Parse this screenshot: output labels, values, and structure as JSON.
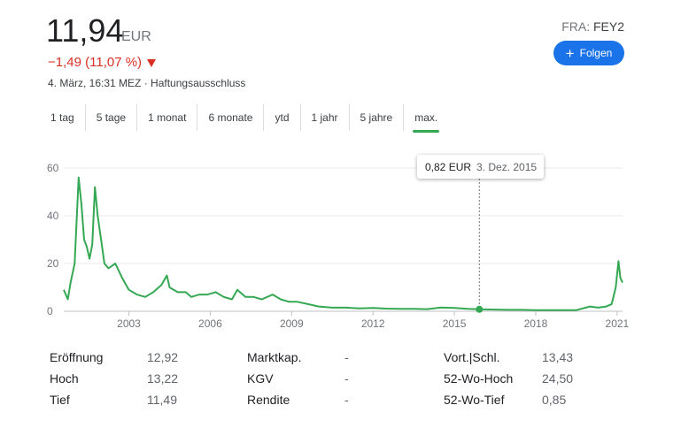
{
  "quote": {
    "price": "11,94",
    "currency": "EUR",
    "change": "−1,49 (11,07 %)",
    "meta": "4. März, 16:31 MEZ · Haftungsausschluss",
    "exchange": "FRA:",
    "symbol": "FEY2",
    "follow_label": "Folgen",
    "change_color": "#d93025"
  },
  "tabs": [
    "1 tag",
    "5 tage",
    "1 monat",
    "6 monate",
    "ytd",
    "1 jahr",
    "5 jahre",
    "max."
  ],
  "active_tab": "max.",
  "tooltip": {
    "price": "0,82 EUR",
    "date": "3. Dez. 2015"
  },
  "chart_data": {
    "type": "line",
    "x_ticks": [
      "2003",
      "2006",
      "2009",
      "2012",
      "2015",
      "2018",
      "2021"
    ],
    "y_ticks": [
      "60",
      "40",
      "20",
      "0"
    ],
    "ylim": [
      0,
      60
    ],
    "xlim": [
      2000.6,
      2021.2
    ],
    "line_color": "#34a853",
    "series": [
      {
        "x": [
          2000.6,
          2000.75,
          2000.85,
          2001.0,
          2001.15,
          2001.25,
          2001.35,
          2001.45,
          2001.55,
          2001.65,
          2001.75,
          2001.85,
          2002.0,
          2002.1,
          2002.25,
          2002.5,
          2002.75,
          2003.0,
          2003.3,
          2003.6,
          2003.9,
          2004.2,
          2004.4,
          2004.5,
          2004.8,
          2005.1,
          2005.3,
          2005.6,
          2005.9,
          2006.2,
          2006.5,
          2006.8,
          2007.0,
          2007.3,
          2007.6,
          2007.9,
          2008.1,
          2008.3,
          2008.6,
          2008.9,
          2009.2,
          2009.6,
          2010.0,
          2010.5,
          2011.0,
          2011.5,
          2012.0,
          2012.5,
          2013.0,
          2013.5,
          2014.0,
          2014.5,
          2015.0,
          2015.5,
          2015.92,
          2016.5,
          2017.0,
          2017.5,
          2018.0,
          2018.5,
          2019.0,
          2019.5,
          2020.0,
          2020.3,
          2020.6,
          2020.8,
          2020.95,
          2021.05,
          2021.12,
          2021.2
        ],
        "y": [
          9,
          5,
          12,
          20,
          56,
          45,
          30,
          27,
          22,
          28,
          52,
          40,
          28,
          20,
          18,
          20,
          14,
          9,
          7,
          6,
          8,
          11,
          15,
          10,
          8,
          8,
          6,
          7,
          7,
          8,
          6,
          5,
          9,
          6,
          6,
          5,
          6,
          7,
          5,
          4,
          4,
          3,
          2,
          1.5,
          1.5,
          1.2,
          1.4,
          1.1,
          1.0,
          1.0,
          0.9,
          1.6,
          1.4,
          1.0,
          0.82,
          0.7,
          0.6,
          0.6,
          0.5,
          0.5,
          0.5,
          0.5,
          2,
          1.5,
          2,
          3,
          10,
          21,
          14,
          12
        ]
      }
    ],
    "marker": {
      "x": 2015.92,
      "y": 0.82
    }
  },
  "stats": [
    [
      {
        "label": "Eröffnung",
        "value": "12,92"
      },
      {
        "label": "Marktkap.",
        "value": "-"
      },
      {
        "label": "Vort.|Schl.",
        "value": "13,43"
      }
    ],
    [
      {
        "label": "Hoch",
        "value": "13,22"
      },
      {
        "label": "KGV",
        "value": "-"
      },
      {
        "label": "52-Wo-Hoch",
        "value": "24,50"
      }
    ],
    [
      {
        "label": "Tief",
        "value": "11,49"
      },
      {
        "label": "Rendite",
        "value": "-"
      },
      {
        "label": "52-Wo-Tief",
        "value": "0,85"
      }
    ]
  ]
}
